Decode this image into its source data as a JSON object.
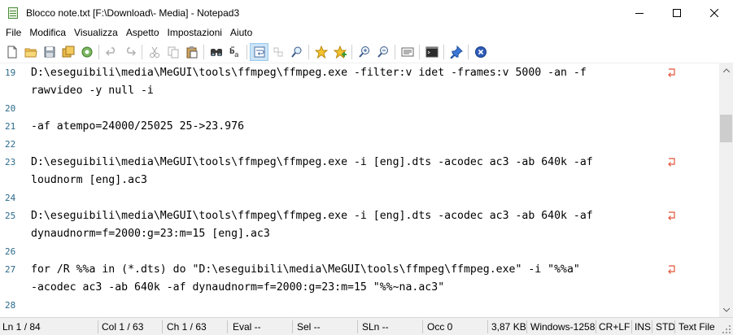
{
  "window": {
    "title": "Blocco note.txt [F:\\Download\\- Media] - Notepad3",
    "icon": "notepad3-icon"
  },
  "menu": {
    "items": [
      "File",
      "Modifica",
      "Visualizza",
      "Aspetto",
      "Impostazioni",
      "Aiuto"
    ]
  },
  "toolbar": {
    "buttons": [
      "new-file-icon",
      "open-folder-icon",
      "save-icon",
      "save-all-icon",
      "browse-icon",
      "undo-icon",
      "redo-icon",
      "cut-icon",
      "copy-icon",
      "paste-icon",
      "find-icon",
      "replace-icon",
      "word-wrap-icon",
      "block-icon",
      "zoom-icon",
      "favorite-star-icon",
      "add-favorite-icon",
      "zoom-in-icon",
      "zoom-out-icon",
      "schemes-icon",
      "console-icon",
      "pin-icon",
      "close-icon"
    ]
  },
  "editor": {
    "lines": [
      {
        "num": "19",
        "text": "D:\\eseguibili\\media\\MeGUI\\tools\\ffmpeg\\ffmpeg.exe -filter:v idet -frames:v 5000 -an -f",
        "wrap": true
      },
      {
        "num": "",
        "text": "rawvideo -y null -i",
        "wrap": false
      },
      {
        "num": "20",
        "text": "",
        "wrap": false
      },
      {
        "num": "21",
        "text": "-af atempo=24000/25025 25->23.976",
        "wrap": false
      },
      {
        "num": "22",
        "text": "",
        "wrap": false
      },
      {
        "num": "23",
        "text": "D:\\eseguibili\\media\\MeGUI\\tools\\ffmpeg\\ffmpeg.exe -i [eng].dts -acodec ac3 -ab 640k -af",
        "wrap": true
      },
      {
        "num": "",
        "text": "loudnorm [eng].ac3",
        "wrap": false
      },
      {
        "num": "24",
        "text": "",
        "wrap": false
      },
      {
        "num": "25",
        "text": "D:\\eseguibili\\media\\MeGUI\\tools\\ffmpeg\\ffmpeg.exe -i [eng].dts -acodec ac3 -ab 640k -af",
        "wrap": true
      },
      {
        "num": "",
        "text": "dynaudnorm=f=2000:g=23:m=15 [eng].ac3",
        "wrap": false
      },
      {
        "num": "26",
        "text": "",
        "wrap": false
      },
      {
        "num": "27",
        "text": "for /R %%a in (*.dts) do \"D:\\eseguibili\\media\\MeGUI\\tools\\ffmpeg\\ffmpeg.exe\" -i \"%%a\"",
        "wrap": true
      },
      {
        "num": "",
        "text": "-acodec ac3 -ab 640k -af dynaudnorm=f=2000:g=23:m=15 \"%%~na.ac3\"",
        "wrap": false
      },
      {
        "num": "28",
        "text": "",
        "wrap": false
      }
    ]
  },
  "status": {
    "ln": "Ln 1 / 84",
    "col": "Col 1 / 63",
    "ch": "Ch 1 / 63",
    "eval": "Eval --",
    "sel": "Sel --",
    "sln": "SLn --",
    "occ": "Occ 0",
    "size": "3,87 KB",
    "encoding": "Windows-1258",
    "eol": "CR+LF",
    "ins": "INS",
    "std": "STD",
    "lexer": "Text File"
  },
  "colors": {
    "line_number": "#2b6a8a",
    "wrap_marker": "#e2553a",
    "pressed_button": "#cce4f7"
  }
}
